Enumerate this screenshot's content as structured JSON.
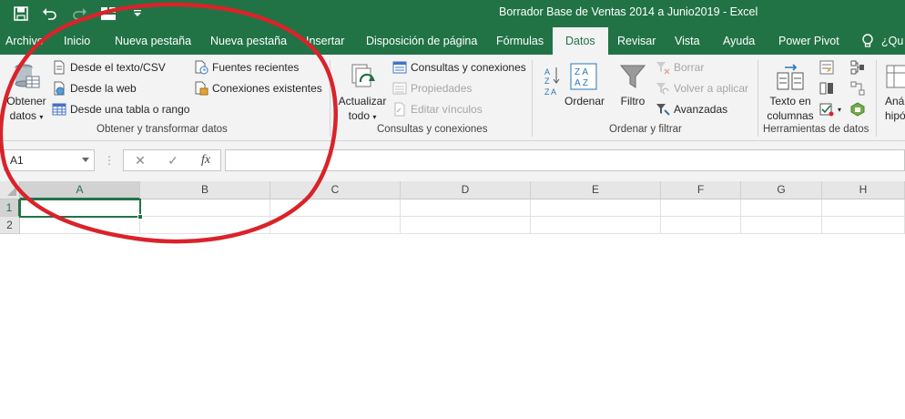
{
  "window": {
    "title": "Borrador Base de Ventas 2014 a Junio2019  -  Excel",
    "accent_color": "#217346"
  },
  "quick_access": {
    "icons": [
      "save-icon",
      "undo-icon",
      "redo-icon",
      "layout-icon",
      "customize-icon"
    ]
  },
  "tabs": [
    {
      "label": "Archivo"
    },
    {
      "label": "Inicio"
    },
    {
      "label": "Nueva pestaña"
    },
    {
      "label": "Nueva pestaña"
    },
    {
      "label": "Insertar"
    },
    {
      "label": "Disposición de página"
    },
    {
      "label": "Fórmulas"
    },
    {
      "label": "Datos"
    },
    {
      "label": "Revisar"
    },
    {
      "label": "Vista"
    },
    {
      "label": "Ayuda"
    },
    {
      "label": "Power Pivot"
    }
  ],
  "active_tab": "Datos",
  "tell_me": {
    "label": "¿Qu"
  },
  "ribbon": {
    "get_data": {
      "big_button_line1": "Obtener",
      "big_button_line2": "datos",
      "items": [
        {
          "label": "Desde el texto/CSV"
        },
        {
          "label": "Desde la web"
        },
        {
          "label": "Desde una tabla o rango"
        },
        {
          "label": "Fuentes recientes"
        },
        {
          "label": "Conexiones existentes"
        }
      ],
      "group_label": "Obtener y transformar datos"
    },
    "queries": {
      "big_button_line1": "Actualizar",
      "big_button_line2": "todo",
      "items": [
        {
          "label": "Consultas y conexiones",
          "enabled": true
        },
        {
          "label": "Propiedades",
          "enabled": false
        },
        {
          "label": "Editar vínculos",
          "enabled": false
        }
      ],
      "group_label": "Consultas y conexiones"
    },
    "sort_filter": {
      "sort_label": "Ordenar",
      "filter_label": "Filtro",
      "items": [
        {
          "label": "Borrar",
          "enabled": false
        },
        {
          "label": "Volver a aplicar",
          "enabled": false
        },
        {
          "label": "Avanzadas",
          "enabled": true
        }
      ],
      "group_label": "Ordenar y filtrar"
    },
    "data_tools": {
      "text_to_columns_line1": "Texto en",
      "text_to_columns_line2": "columnas",
      "group_label": "Herramientas de datos"
    },
    "forecast": {
      "line1": "Aná",
      "line2": "hipó"
    }
  },
  "formula_bar": {
    "name_box": "A1",
    "dots": "⋮",
    "cancel": "✕",
    "enter": "✓",
    "fx": "fx",
    "formula": ""
  },
  "grid": {
    "columns": [
      "A",
      "B",
      "C",
      "D",
      "E",
      "F",
      "G",
      "H"
    ],
    "rows": [
      "1",
      "2"
    ],
    "selected_cell": "A1"
  },
  "annotation": {
    "color": "#d9232a",
    "shape": "ellipse"
  }
}
